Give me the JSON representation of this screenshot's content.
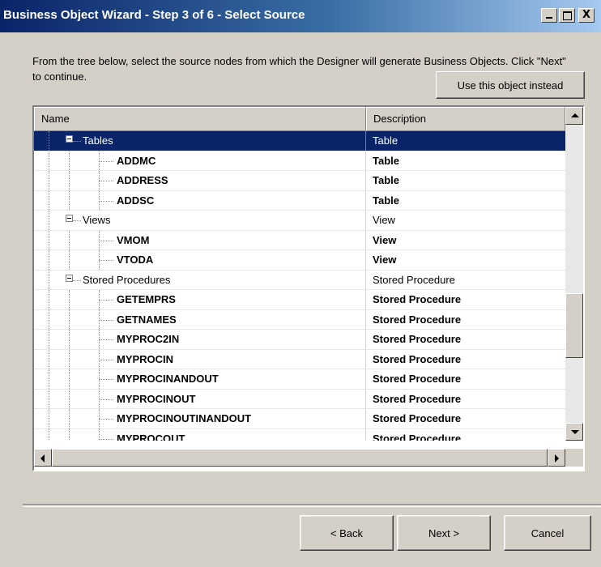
{
  "window": {
    "title": "Business Object Wizard - Step 3 of 6 - Select Source",
    "minimize_label": "",
    "close_label": "X"
  },
  "instruction": "From the tree below, select the source nodes from which the Designer will generate Business Objects. Click \"Next\" to continue.",
  "use_object_button": "Use this object instead",
  "columns": {
    "name": "Name",
    "description": "Description"
  },
  "rows": [
    {
      "name": "Tables",
      "description": "Table",
      "level": 1,
      "expander": true,
      "selected": true,
      "bold": false
    },
    {
      "name": "ADDMC",
      "description": "Table",
      "level": 2,
      "bold": true
    },
    {
      "name": "ADDRESS",
      "description": "Table",
      "level": 2,
      "bold": true
    },
    {
      "name": "ADDSC",
      "description": "Table",
      "level": 2,
      "bold": true
    },
    {
      "name": "Views",
      "description": "View",
      "level": 1,
      "expander": true,
      "bold": false
    },
    {
      "name": "VMOM",
      "description": "View",
      "level": 2,
      "bold": true
    },
    {
      "name": "VTODA",
      "description": "View",
      "level": 2,
      "bold": true
    },
    {
      "name": "Stored Procedures",
      "description": "Stored Procedure",
      "level": 1,
      "expander": true,
      "bold": false
    },
    {
      "name": "GETEMPRS",
      "description": "Stored Procedure",
      "level": 2,
      "bold": true
    },
    {
      "name": "GETNAMES",
      "description": "Stored Procedure",
      "level": 2,
      "bold": true
    },
    {
      "name": "MYPROC2IN",
      "description": "Stored Procedure",
      "level": 2,
      "bold": true
    },
    {
      "name": "MYPROCIN",
      "description": "Stored Procedure",
      "level": 2,
      "bold": true
    },
    {
      "name": "MYPROCINANDOUT",
      "description": "Stored Procedure",
      "level": 2,
      "bold": true
    },
    {
      "name": "MYPROCINOUT",
      "description": "Stored Procedure",
      "level": 2,
      "bold": true
    },
    {
      "name": "MYPROCINOUTINANDOUT",
      "description": "Stored Procedure",
      "level": 2,
      "bold": true
    },
    {
      "name": "MYPROCOUT",
      "description": "Stored Procedure",
      "level": 2,
      "bold": true
    }
  ],
  "buttons": {
    "back": "< Back",
    "next": "Next >",
    "cancel": "Cancel"
  },
  "colors": {
    "title_start": "#0a246a",
    "title_end": "#a6caf0",
    "selection": "#0a246a",
    "face": "#d4d0c8"
  }
}
